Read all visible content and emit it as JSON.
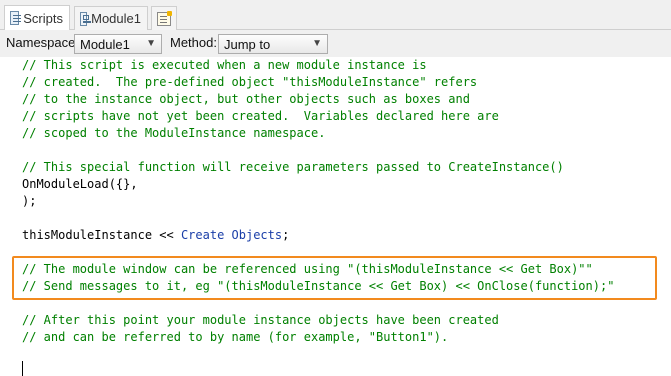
{
  "tabs": [
    {
      "label": "Scripts",
      "icon": "scripts-icon",
      "active": true
    },
    {
      "label": "Module1",
      "icon": "module-icon",
      "active": false
    },
    {
      "label": "",
      "icon": "new-module-icon",
      "active": false
    }
  ],
  "toolbar": {
    "namespace_label": "Namespace:",
    "namespace_value": "Module1",
    "method_label": "Method:",
    "method_value": "Jump to"
  },
  "code": {
    "lines": [
      "// This script is executed when a new module instance is",
      "// created.  The pre-defined object \"thisModuleInstance\" refers",
      "// to the instance object, but other objects such as boxes and",
      "// scripts have not yet been created.  Variables declared here are",
      "// scoped to the ModuleInstance namespace.",
      "",
      "// This special function will receive parameters passed to CreateInstance()",
      "OnModuleLoad({},",
      ");",
      "",
      "thisModuleInstance << ",
      "",
      "// The module window can be referenced using \"(thisModuleInstance << Get Box)\"\"",
      "// Send messages to it, eg \"(thisModuleInstance << Get Box) << OnClose(function);\"",
      "",
      "// After this point your module instance objects have been created",
      "// and can be referred to by name (for example, \"Button1\")."
    ],
    "line11_keyword": "Create Objects",
    "line11_suffix": ";"
  },
  "colors": {
    "comment": "#008000",
    "keyword": "#1a3ea8",
    "highlight_border": "#f28a1e"
  }
}
